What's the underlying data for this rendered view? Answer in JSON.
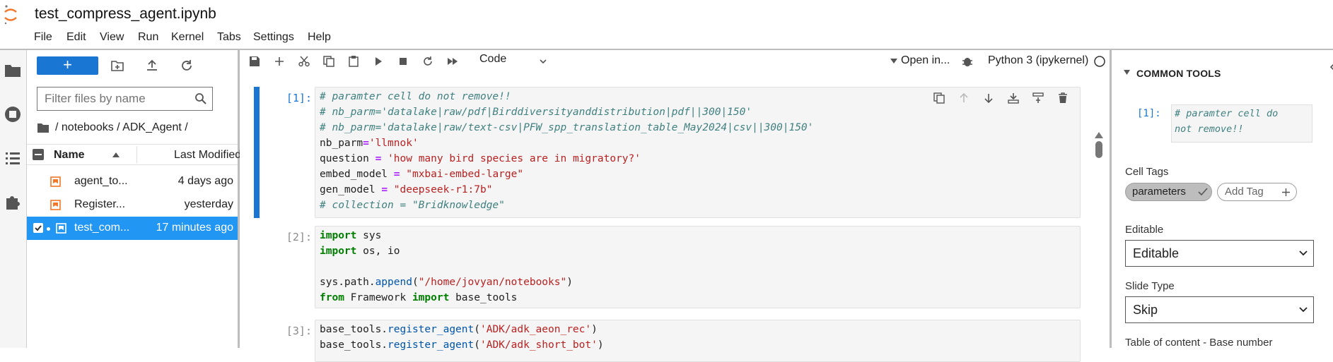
{
  "app": {
    "notebook_title": "test_compress_agent.ipynb"
  },
  "menu": [
    "File",
    "Edit",
    "View",
    "Run",
    "Kernel",
    "Tabs",
    "Settings",
    "Help"
  ],
  "filebrowser": {
    "new_label": "+",
    "filter_placeholder": "Filter files by name",
    "breadcrumb": "/ notebooks / ADK_Agent /",
    "columns": {
      "name": "Name",
      "modified": "Last Modified"
    },
    "files": [
      {
        "name": "agent_to...",
        "modified": "4 days ago"
      },
      {
        "name": "Register...",
        "modified": "yesterday"
      },
      {
        "name": "test_com...",
        "modified": "17 minutes ago"
      }
    ]
  },
  "toolbar": {
    "cell_type": "Code",
    "open_in": "Open in...",
    "kernel": "Python 3 (ipykernel)"
  },
  "cells": [
    {
      "prompt": "[1]:",
      "lines": [
        "# paramter cell do not remove!!",
        "# nb_parm='datalake|raw/pdf|Birddiversityanddistribution|pdf||300|150'",
        "# nb_parm='datalake|raw/text-csv|PFW_spp_translation_table_May2024|csv||300|150'",
        "nb_parm='llmnok'",
        "question = 'how many bird species are in migratory?'",
        "embed_model = \"mxbai-embed-large\"",
        "gen_model = \"deepseek-r1:7b\"",
        "# collection = \"Bridknowledge\""
      ]
    },
    {
      "prompt": "[2]:",
      "lines": [
        "import sys",
        "import os, io",
        "",
        "sys.path.append(\"/home/jovyan/notebooks\")",
        "from Framework import base_tools"
      ]
    },
    {
      "prompt": "[3]:",
      "lines": [
        "base_tools.register_agent('ADK/adk_aeon_rec')",
        "base_tools.register_agent('ADK/adk_short_bot')"
      ]
    }
  ],
  "right_panel": {
    "header": "COMMON TOOLS",
    "mini_prompt": "[1]:",
    "mini_text_line1": "# paramter cell do",
    "mini_text_line2": "not remove!!",
    "cell_tags_label": "Cell Tags",
    "tag_active": "parameters",
    "tag_add": "Add Tag",
    "editable_label": "Editable",
    "editable_value": "Editable",
    "slide_type_label": "Slide Type",
    "slide_type_value": "Skip",
    "toc_label": "Table of content - Base number"
  }
}
